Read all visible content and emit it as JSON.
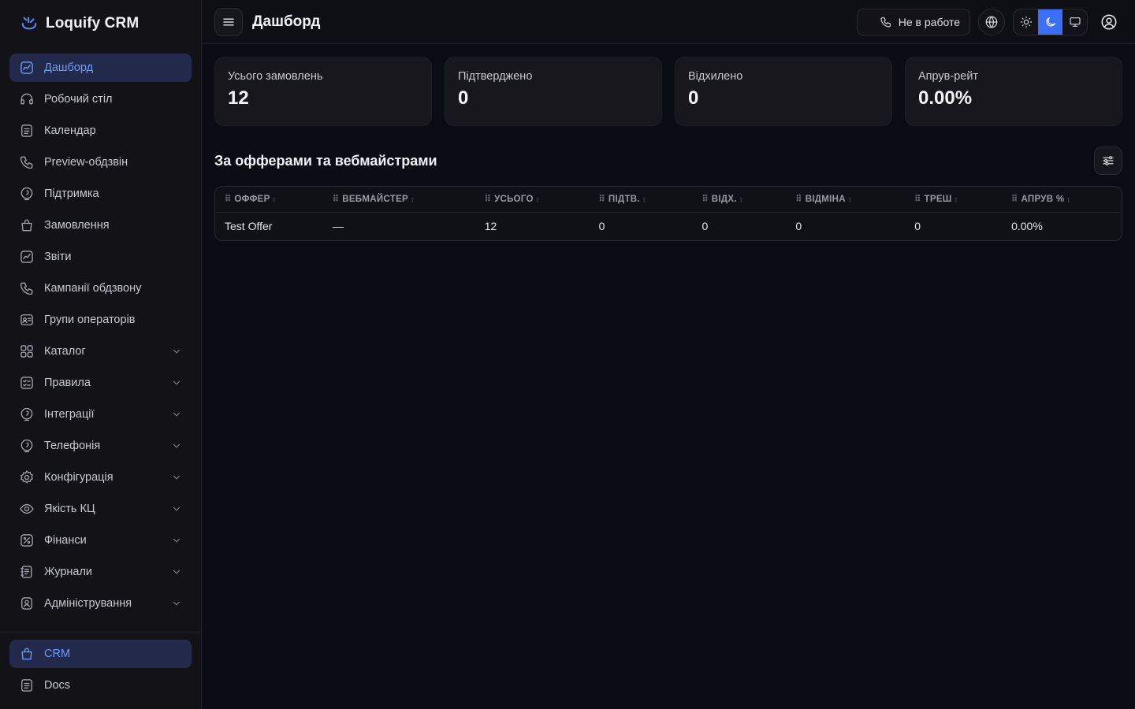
{
  "brand": {
    "name": "Loquify CRM",
    "accent": "#5b8cff"
  },
  "sidebar": {
    "items": [
      {
        "label": "Дашборд",
        "icon": "dashboard-icon",
        "active": true,
        "expandable": false
      },
      {
        "label": "Робочий стіл",
        "icon": "headset-icon",
        "expandable": false
      },
      {
        "label": "Календар",
        "icon": "document-icon",
        "expandable": false
      },
      {
        "label": "Preview-обдзвін",
        "icon": "phone-icon",
        "expandable": false
      },
      {
        "label": "Підтримка",
        "icon": "support-icon",
        "expandable": false
      },
      {
        "label": "Замовлення",
        "icon": "bag-icon",
        "expandable": false
      },
      {
        "label": "Звіти",
        "icon": "chart-icon",
        "expandable": false
      },
      {
        "label": "Кампанії обдзвону",
        "icon": "phone-icon",
        "expandable": false
      },
      {
        "label": "Групи операторів",
        "icon": "contacts-icon",
        "expandable": false
      },
      {
        "label": "Каталог",
        "icon": "grid-icon",
        "expandable": true
      },
      {
        "label": "Правила",
        "icon": "checklist-icon",
        "expandable": true
      },
      {
        "label": "Інтеграції",
        "icon": "support-icon",
        "expandable": true
      },
      {
        "label": "Телефонія",
        "icon": "support-icon",
        "expandable": true
      },
      {
        "label": "Конфігурація",
        "icon": "gear-icon",
        "expandable": true
      },
      {
        "label": "Якість КЦ",
        "icon": "eye-icon",
        "expandable": true
      },
      {
        "label": "Фінанси",
        "icon": "percent-icon",
        "expandable": true
      },
      {
        "label": "Журнали",
        "icon": "journal-icon",
        "expandable": true
      },
      {
        "label": "Адміністрування",
        "icon": "user-shield-icon",
        "expandable": true
      }
    ],
    "bottom": [
      {
        "label": "CRM",
        "icon": "bag-icon",
        "active": true
      },
      {
        "label": "Docs",
        "icon": "document-icon",
        "active": false
      }
    ]
  },
  "header": {
    "title": "Дашборд",
    "status_label": "Не в работе",
    "theme_selected": "dark"
  },
  "stats": [
    {
      "label": "Усього замовлень",
      "value": "12"
    },
    {
      "label": "Підтверджено",
      "value": "0"
    },
    {
      "label": "Відхилено",
      "value": "0"
    },
    {
      "label": "Апрув-рейт",
      "value": "0.00%"
    }
  ],
  "section": {
    "title": "За офферами та вебмайстрами",
    "columns": [
      "ОФФЕР",
      "ВЕБМАЙСТЕР",
      "УСЬОГО",
      "ПІДТВ.",
      "ВІДХ.",
      "ВІДМІНА",
      "ТРЕШ",
      "АПРУВ %"
    ],
    "rows": [
      [
        "Test Offer",
        "—",
        "12",
        "0",
        "0",
        "0",
        "0",
        "0.00%"
      ]
    ]
  },
  "colors": {
    "background": "#0b0b14",
    "sidebar": "#121217",
    "card": "#17171d",
    "active_item_bg": "#23294a",
    "active_item_text": "#6d9bff",
    "theme_toggle_on": "#3b6ff5"
  }
}
